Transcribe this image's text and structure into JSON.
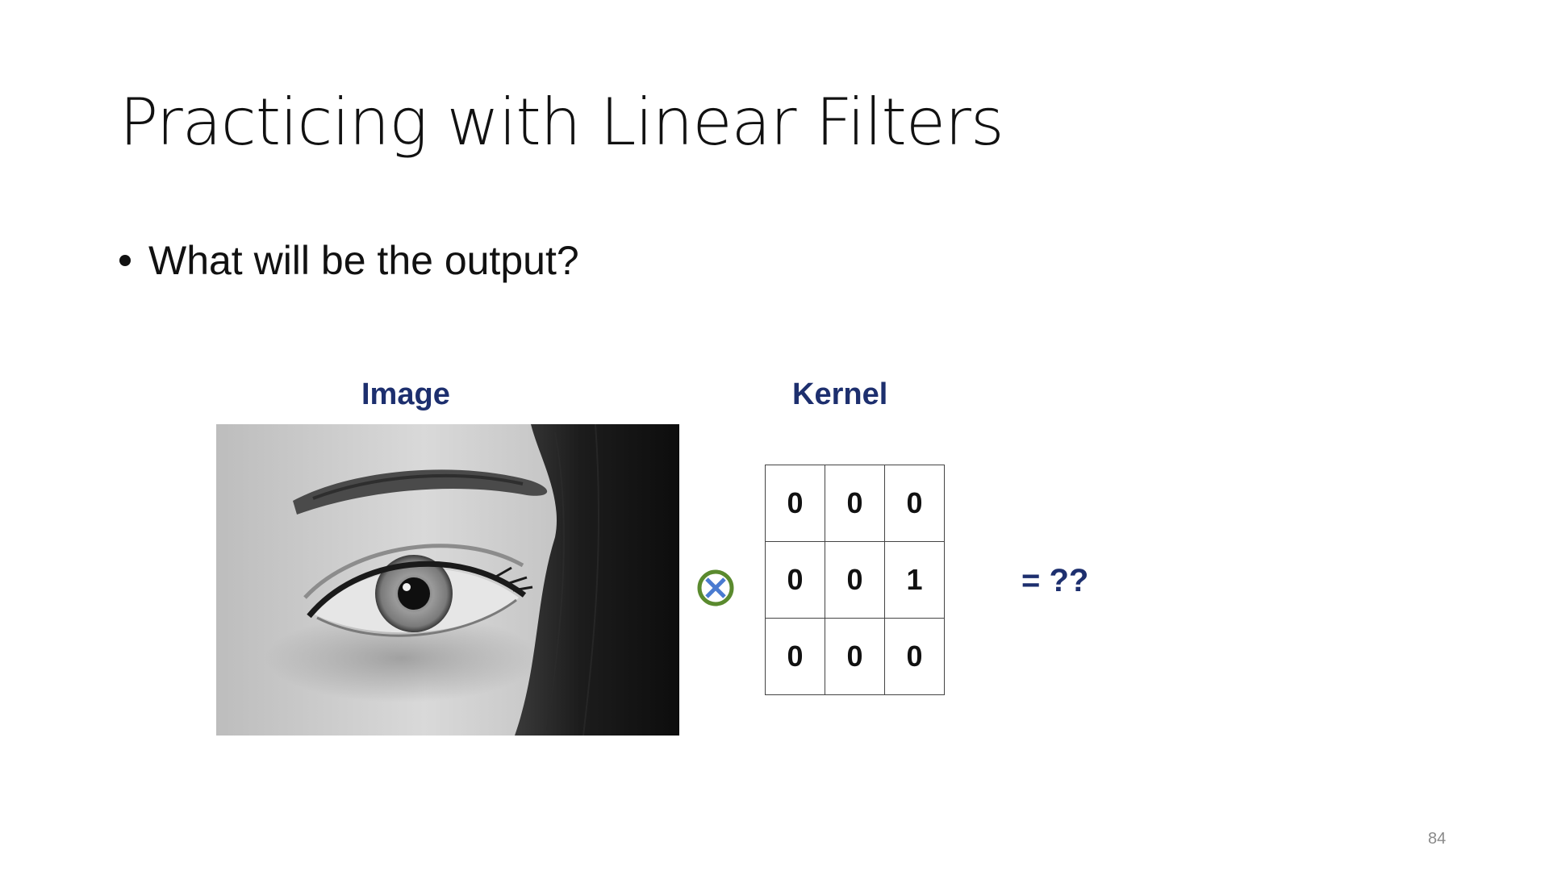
{
  "slide": {
    "title": "Practicing with Linear Filters",
    "bullets": [
      "What will be the output?"
    ],
    "image_label": "Image",
    "kernel_label": "Kernel",
    "kernel": [
      [
        "0",
        "0",
        "0"
      ],
      [
        "0",
        "0",
        "1"
      ],
      [
        "0",
        "0",
        "0"
      ]
    ],
    "operator_icon": "convolution-circle-x-icon",
    "result_text": "= ??",
    "page_number": "84"
  },
  "colors": {
    "label_color": "#1d2f6e",
    "operator_ring": "#5a8a2e",
    "operator_x": "#4a7bd0",
    "page_number_color": "#8a8a8a"
  }
}
